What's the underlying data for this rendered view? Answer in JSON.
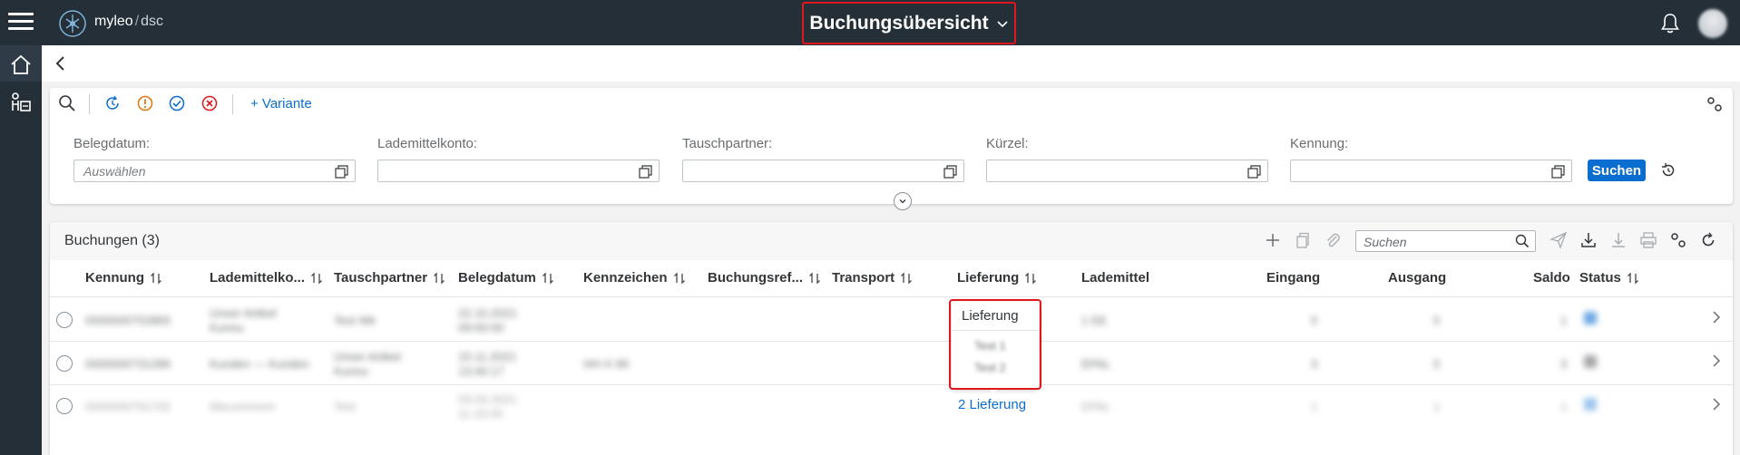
{
  "header": {
    "brand": "myleo",
    "brand_sep": "/",
    "brand_sub": "dsc",
    "title": "Buchungsübersicht"
  },
  "filter": {
    "variante_label": "+ Variante",
    "fields": [
      {
        "label": "Belegdatum:",
        "placeholder": "Auswählen"
      },
      {
        "label": "Lademittelkonto:",
        "placeholder": ""
      },
      {
        "label": "Tauschpartner:",
        "placeholder": ""
      },
      {
        "label": "Kürzel:",
        "placeholder": ""
      },
      {
        "label": "Kennung:",
        "placeholder": ""
      }
    ],
    "search_label": "Suchen"
  },
  "table": {
    "title": "Buchungen (3)",
    "search_placeholder": "Suchen",
    "columns": [
      "Kennung",
      "Lademittelko...",
      "Tauschpartner",
      "Belegdatum",
      "Kennzeichen",
      "Buchungsref...",
      "Transport",
      "Lieferung",
      "Lademittel",
      "Eingang",
      "Ausgang",
      "Saldo",
      "Status"
    ],
    "rows": [
      {
        "kennung": "0000000752865",
        "lademittelkonto": "Unser Artikel Kunnu",
        "tauschpartner": "Test Wk",
        "belegdatum": "22.10.2021 09:00:00",
        "kennzeichen": "",
        "lademittel": "1 EE",
        "eingang": "5",
        "ausgang": "0",
        "saldo": "1"
      },
      {
        "kennung": "0000000731286",
        "lademittelkonto": "Kunden — Kunden",
        "tauschpartner": "Unser Artikel Kunnu",
        "belegdatum": "15.11.2021 13:40:17",
        "kennzeichen": "HH-X 99",
        "lademittel": "EPAL",
        "eingang": "3",
        "ausgang": "0",
        "saldo": "3"
      },
      {
        "kennung": "0000000791702",
        "lademittelkonto": "Mecomment",
        "tauschpartner": "Test",
        "belegdatum": "03.03.2021 11:15:00",
        "kennzeichen": "",
        "lademittel": "EPAL",
        "eingang": "1",
        "ausgang": "1",
        "saldo": "1"
      }
    ]
  },
  "popover": {
    "header": "Lieferung",
    "items": [
      "Test 1",
      "Test 2"
    ],
    "link": "2 Lieferung"
  },
  "colors": {
    "topbar": "#242f38",
    "accent": "#0a6ed1",
    "highlight": "#e0171f"
  }
}
